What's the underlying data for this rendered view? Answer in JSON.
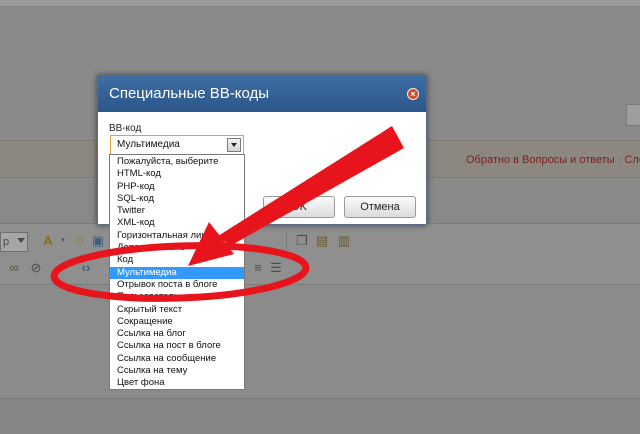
{
  "background": {
    "nav_links_primary": "Обратно в Вопросы и ответы",
    "nav_links_separator": " · ",
    "nav_links_secondary": "Следу"
  },
  "dialog": {
    "title": "Специальные BB-коды",
    "field_label": "BB-код",
    "selected_value": "Мультимедиа",
    "ok_label": "OK",
    "cancel_label": "Отмена"
  },
  "dropdown": {
    "options": [
      "Пожалуйста, выберите",
      "HTML-код",
      "PHP-код",
      "SQL-код",
      "Twitter",
      "XML-код",
      "Горизонтальная линия",
      "Дополнительно",
      "Код",
      "Мультимедиа",
      "Отрывок поста в блоге",
      "Пользователь",
      "Скрытый текст",
      "Сокращение",
      "Ссылка на блог",
      "Ссылка на пост в блоге",
      "Ссылка на сообщение",
      "Ссылка на тему",
      "Цвет фона"
    ],
    "selected_index": 9
  },
  "colors": {
    "title_bar": "#2f5c91",
    "selection": "#3399ff",
    "annotation_red": "#e8141c",
    "close_button": "#d44a22"
  },
  "icons": [
    "close-icon",
    "chevron-down-icon",
    "text-color-icon",
    "smiley-icon",
    "paste-icon",
    "align-icon",
    "link-icon",
    "code-icon"
  ]
}
